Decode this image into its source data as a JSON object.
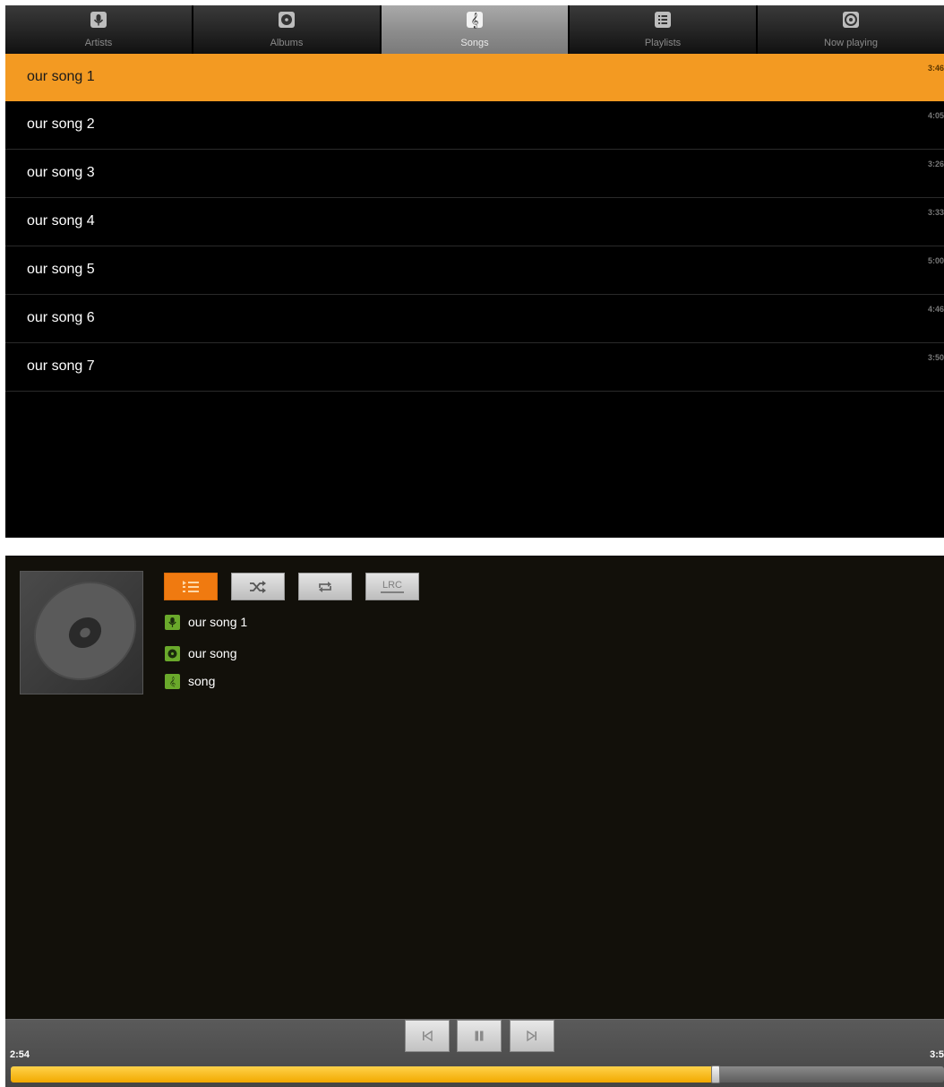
{
  "tabs": [
    {
      "label": "Artists",
      "icon": "microphone-icon",
      "selected": false
    },
    {
      "label": "Albums",
      "icon": "album-disc-icon",
      "selected": false
    },
    {
      "label": "Songs",
      "icon": "treble-clef-icon",
      "selected": true
    },
    {
      "label": "Playlists",
      "icon": "playlist-icon",
      "selected": false
    },
    {
      "label": "Now playing",
      "icon": "now-playing-icon",
      "selected": false
    }
  ],
  "songs": [
    {
      "title": "our song 1",
      "duration": "3:46",
      "selected": true
    },
    {
      "title": "our song 2",
      "duration": "4:05",
      "selected": false
    },
    {
      "title": "our song 3",
      "duration": "3:26",
      "selected": false
    },
    {
      "title": "our song 4",
      "duration": "3:33",
      "selected": false
    },
    {
      "title": "our song 5",
      "duration": "5:00",
      "selected": false
    },
    {
      "title": "our song 6",
      "duration": "4:46",
      "selected": false
    },
    {
      "title": "our song 7",
      "duration": "3:50",
      "selected": false
    }
  ],
  "now_playing": {
    "controls": [
      {
        "name": "queue-button",
        "icon": "queue-list-icon",
        "active": true
      },
      {
        "name": "shuffle-button",
        "icon": "shuffle-icon",
        "active": false
      },
      {
        "name": "repeat-button",
        "icon": "repeat-icon",
        "active": false
      },
      {
        "name": "lyrics-button",
        "label": "LRC",
        "active": false
      }
    ],
    "artist": "our song 1",
    "album": "our song",
    "track": "song",
    "time_current": "2:54",
    "time_total": "3:5",
    "progress_fraction": 0.755
  },
  "colors": {
    "accent_orange": "#f39a22",
    "active_button": "#f07a10",
    "info_icon_green": "#6aa92b",
    "progress_yellow": "#f2a900"
  }
}
